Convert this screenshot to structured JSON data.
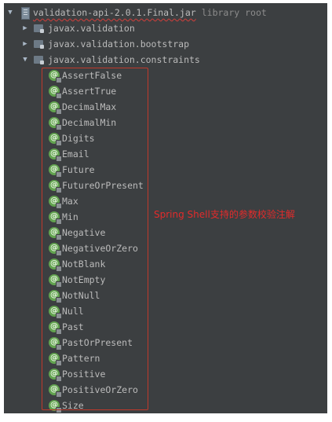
{
  "tree": {
    "root": {
      "name": "validation-api-2.0.1.Final.jar",
      "suffix": "library root",
      "expanded": true
    },
    "packages": [
      {
        "name": "javax.validation",
        "expanded": false
      },
      {
        "name": "javax.validation.bootstrap",
        "expanded": false
      },
      {
        "name": "javax.validation.constraints",
        "expanded": true
      }
    ],
    "constraints": [
      "AssertFalse",
      "AssertTrue",
      "DecimalMax",
      "DecimalMin",
      "Digits",
      "Email",
      "Future",
      "FutureOrPresent",
      "Max",
      "Min",
      "Negative",
      "NegativeOrZero",
      "NotBlank",
      "NotEmpty",
      "NotNull",
      "Null",
      "Past",
      "PastOrPresent",
      "Pattern",
      "Positive",
      "PositiveOrZero",
      "Size"
    ]
  },
  "icons": {
    "expanded_arrow": "▼",
    "collapsed_arrow": "▶",
    "annotation_glyph": "@"
  },
  "annotation_text": "Spring Shell支持的参数校验注解",
  "colors": {
    "panel_bg": "#3c3f41",
    "text": "#bbbbbb",
    "annotation_icon": "#62a34f",
    "highlight": "#c0392b",
    "annotation_text": "#e32b2b"
  }
}
